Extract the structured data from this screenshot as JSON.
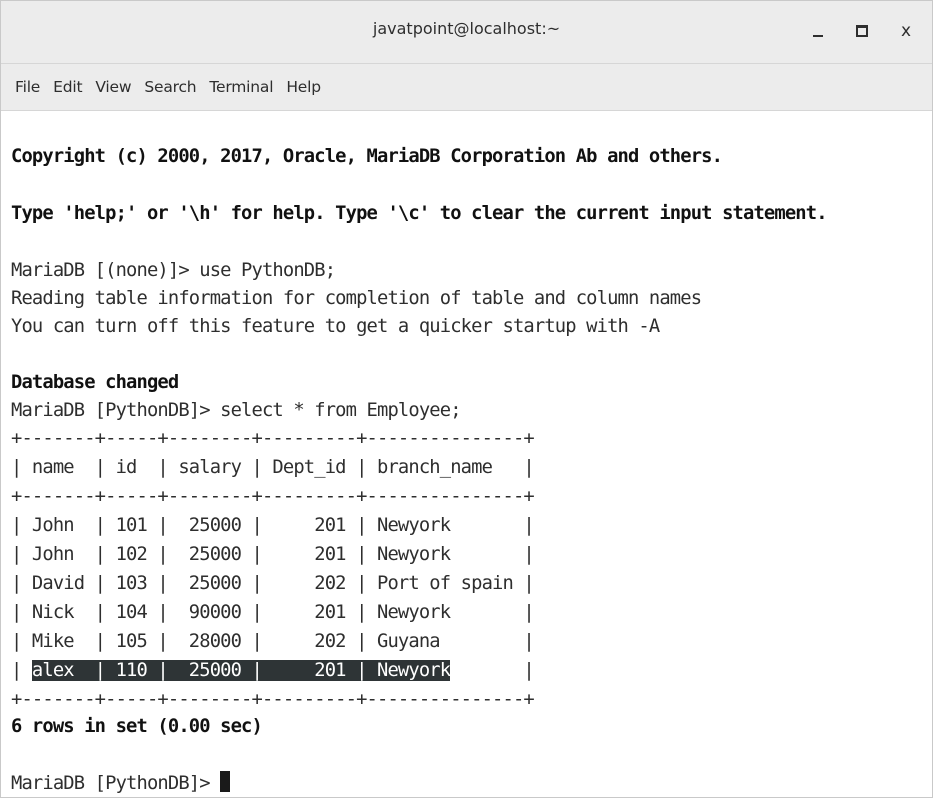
{
  "window": {
    "title": "javatpoint@localhost:~",
    "minimize_label": "_",
    "close_label": "x"
  },
  "menubar": {
    "items": [
      "File",
      "Edit",
      "View",
      "Search",
      "Terminal",
      "Help"
    ]
  },
  "terminal": {
    "copyright": "Copyright (c) 2000, 2017, Oracle, MariaDB Corporation Ab and others.",
    "help_hint": "Type 'help;' or '\\h' for help. Type '\\c' to clear the current input statement.",
    "cmd_use": "MariaDB [(none)]> use PythonDB;",
    "reading_info": "Reading table information for completion of table and column names",
    "turn_off_info": "You can turn off this feature to get a quicker startup with -A",
    "db_changed": "Database changed",
    "cmd_select": "MariaDB [PythonDB]> select * from Employee;",
    "table_border": "+-------+-----+--------+---------+---------------+",
    "table_header": "| name  | id  | salary | Dept_id | branch_name   |",
    "rows": [
      "| John  | 101 |  25000 |     201 | Newyork       |",
      "| John  | 102 |  25000 |     201 | Newyork       |",
      "| David | 103 |  25000 |     202 | Port of spain |",
      "| Nick  | 104 |  90000 |     201 | Newyork       |",
      "| Mike  | 105 |  28000 |     202 | Guyana        |"
    ],
    "last_row": {
      "prefix": "| ",
      "selected": "alex  | 110 |  25000 |     201 | Newyork",
      "suffix": "       |"
    },
    "result_summary": "6 rows in set (0.00 sec)",
    "prompt": "MariaDB [PythonDB]> "
  }
}
